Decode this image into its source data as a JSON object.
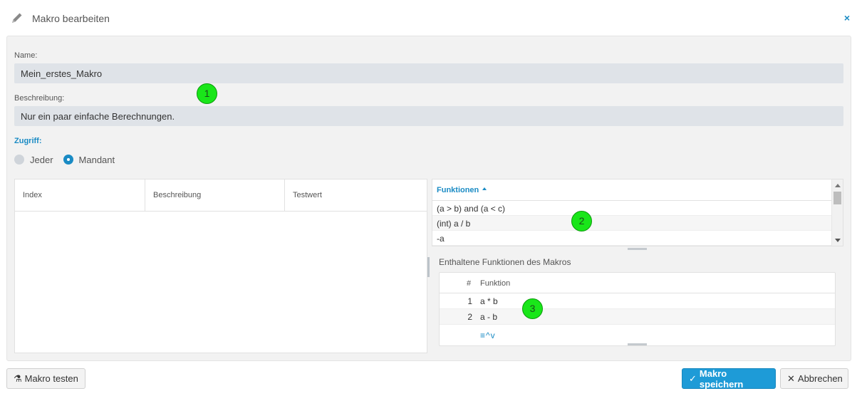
{
  "dialog": {
    "title": "Makro bearbeiten",
    "close_icon": "×",
    "accent_color": "#1a8bc4"
  },
  "form": {
    "name_label": "Name:",
    "name_value": "Mein_erstes_Makro",
    "description_label": "Beschreibung:",
    "description_value": "Nur ein paar einfache Berechnungen.",
    "access_label": "Zugriff:",
    "access_options": [
      {
        "label": "Jeder",
        "selected": false
      },
      {
        "label": "Mandant",
        "selected": true
      }
    ]
  },
  "parameters_table": {
    "columns": [
      "Index",
      "Beschreibung",
      "Testwert"
    ],
    "rows": []
  },
  "functions_list": {
    "header": "Funktionen",
    "sort": "ascending",
    "items": [
      "(a > b) and (a < c)",
      "(int) a / b",
      "-a"
    ]
  },
  "contained_functions": {
    "label": "Enthaltene Funktionen des Makros",
    "columns": [
      "#",
      "Funktion"
    ],
    "rows": [
      {
        "num": "1",
        "func": "a * b"
      },
      {
        "num": "2",
        "func": "a - b"
      }
    ],
    "tools": [
      "≡",
      "^",
      "v"
    ]
  },
  "markers": [
    "1",
    "2",
    "3"
  ],
  "buttons": {
    "test_icon": "⚗",
    "test": "Makro testen",
    "save_icon": "✓",
    "save": "Makro speichern",
    "cancel_icon": "✕",
    "cancel": "Abbrechen"
  }
}
